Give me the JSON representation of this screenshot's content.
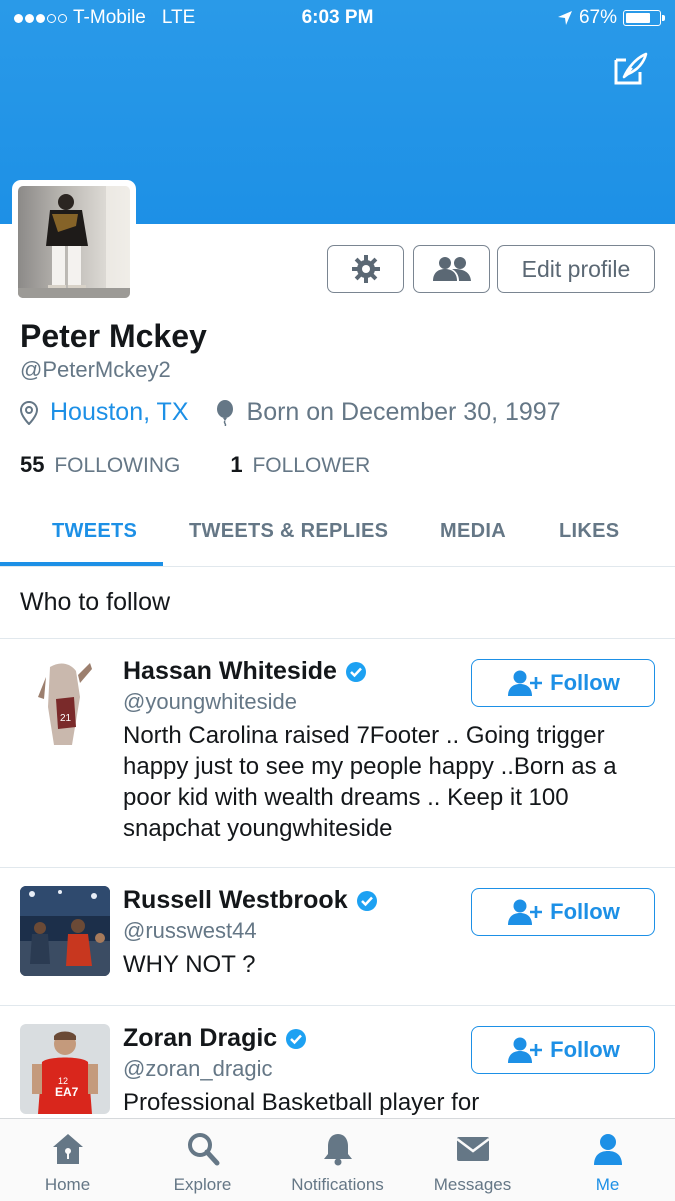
{
  "status_bar": {
    "carrier": "T-Mobile",
    "network": "LTE",
    "time": "6:03 PM",
    "battery": "67%",
    "battery_level": 0.67
  },
  "profile": {
    "name": "Peter Mckey",
    "handle": "@PeterMckey2",
    "location": "Houston, TX",
    "born": "Born on December 30, 1997",
    "following_count": "55",
    "following_label": "FOLLOWING",
    "followers_count": "1",
    "followers_label": "FOLLOWER",
    "edit_label": "Edit profile"
  },
  "tabs": [
    {
      "label": "TWEETS",
      "active": true
    },
    {
      "label": "TWEETS & REPLIES",
      "active": false
    },
    {
      "label": "MEDIA",
      "active": false
    },
    {
      "label": "LIKES",
      "active": false
    }
  ],
  "who_to_follow": {
    "title": "Who to follow",
    "follow_label": "Follow",
    "items": [
      {
        "name": "Hassan Whiteside",
        "handle": "@youngwhiteside",
        "bio": "North Carolina raised 7Footer .. Going trigger happy just to see my people happy ..Born as a poor kid with wealth dreams .. Keep it 100 snapchat youngwhiteside",
        "verified": true
      },
      {
        "name": "Russell Westbrook",
        "handle": "@russwest44",
        "bio": "WHY NOT ?",
        "verified": true
      },
      {
        "name": "Zoran Dragic",
        "handle": "@zoran_dragic",
        "bio": "Professional Basketball player for",
        "verified": true
      }
    ]
  },
  "tabbar": [
    {
      "label": "Home",
      "icon": "home-icon",
      "active": false
    },
    {
      "label": "Explore",
      "icon": "search-icon",
      "active": false
    },
    {
      "label": "Notifications",
      "icon": "bell-icon",
      "active": false
    },
    {
      "label": "Messages",
      "icon": "envelope-icon",
      "active": false
    },
    {
      "label": "Me",
      "icon": "person-icon",
      "active": true
    }
  ],
  "colors": {
    "accent": "#1d90e6",
    "header": "#2a9ae8",
    "secondary_text": "#657786",
    "verified": "#1da1f2"
  }
}
